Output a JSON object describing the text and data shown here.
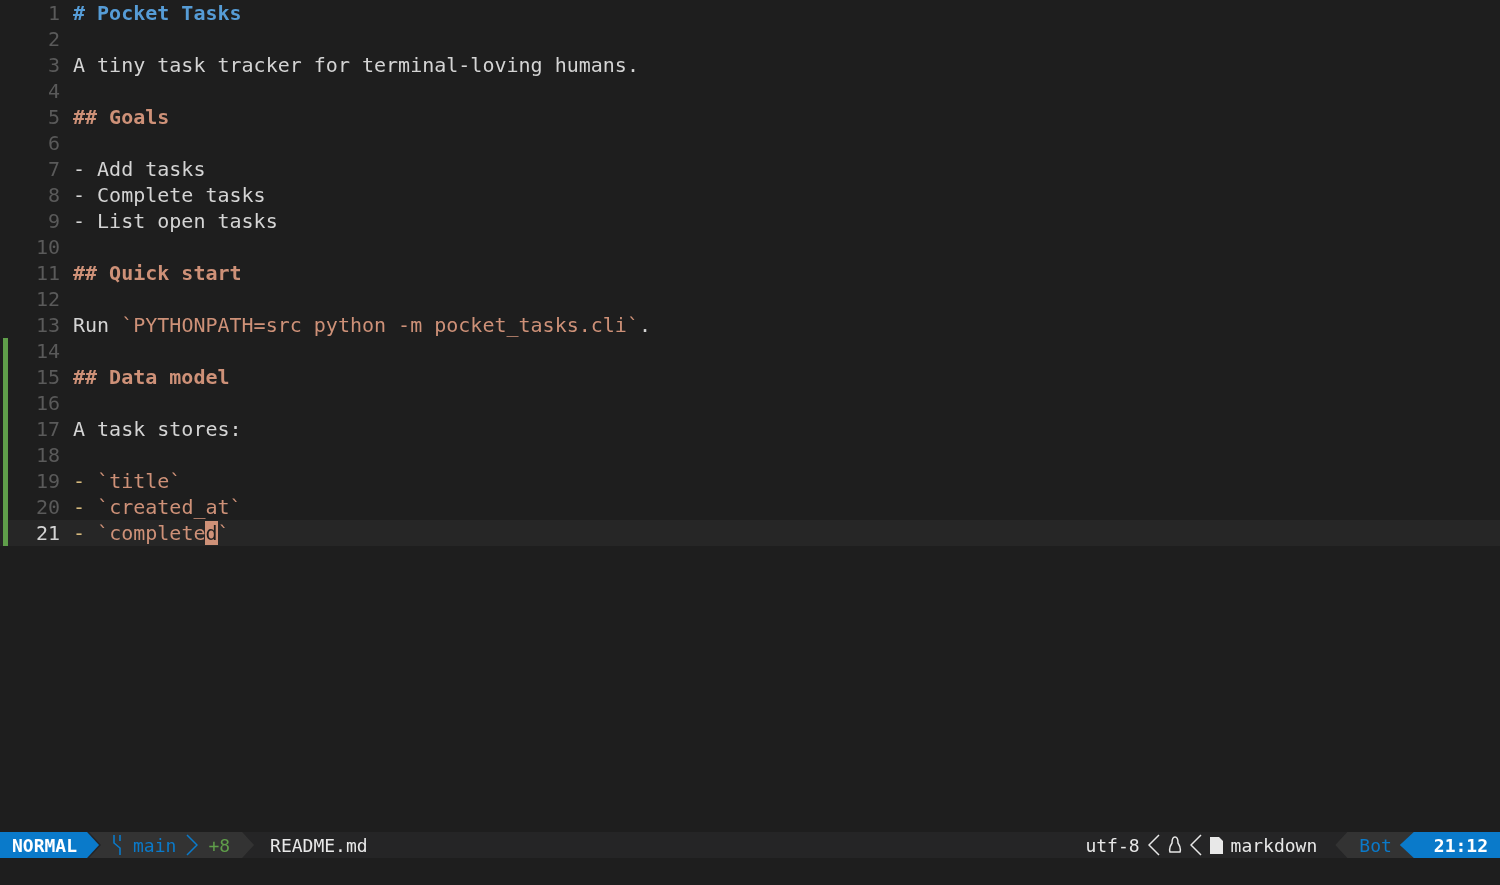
{
  "lines": [
    {
      "number": "1",
      "changed": false,
      "current": false,
      "segments": [
        {
          "kind": "heading1",
          "text": "# Pocket Tasks"
        }
      ]
    },
    {
      "number": "2",
      "changed": false,
      "current": false
    },
    {
      "number": "3",
      "changed": false,
      "current": false,
      "segments": [
        {
          "kind": "text",
          "text": "A tiny task tracker for terminal-loving humans."
        }
      ]
    },
    {
      "number": "4",
      "changed": false,
      "current": false
    },
    {
      "number": "5",
      "changed": false,
      "current": false,
      "segments": [
        {
          "kind": "heading2",
          "text": "## Goals"
        }
      ]
    },
    {
      "number": "6",
      "changed": false,
      "current": false
    },
    {
      "number": "7",
      "changed": false,
      "current": false,
      "segments": [
        {
          "kind": "text",
          "text": "- Add tasks"
        }
      ]
    },
    {
      "number": "8",
      "changed": false,
      "current": false,
      "segments": [
        {
          "kind": "text",
          "text": "- Complete tasks"
        }
      ]
    },
    {
      "number": "9",
      "changed": false,
      "current": false,
      "segments": [
        {
          "kind": "text",
          "text": "- List open tasks"
        }
      ]
    },
    {
      "number": "10",
      "changed": false,
      "current": false
    },
    {
      "number": "11",
      "changed": false,
      "current": false,
      "segments": [
        {
          "kind": "heading2",
          "text": "## Quick start"
        }
      ]
    },
    {
      "number": "12",
      "changed": false,
      "current": false
    },
    {
      "number": "13",
      "changed": false,
      "current": false,
      "segments": [
        {
          "kind": "text",
          "text": "Run "
        },
        {
          "kind": "code",
          "text": "`PYTHONPATH=src python -m pocket_tasks.cli`"
        },
        {
          "kind": "text",
          "text": "."
        }
      ]
    },
    {
      "number": "14",
      "changed": true,
      "current": false
    },
    {
      "number": "15",
      "changed": true,
      "current": false,
      "segments": [
        {
          "kind": "heading2",
          "text": "## Data model"
        }
      ]
    },
    {
      "number": "16",
      "changed": true,
      "current": false
    },
    {
      "number": "17",
      "changed": true,
      "current": false,
      "segments": [
        {
          "kind": "text",
          "text": "A task stores:"
        }
      ]
    },
    {
      "number": "18",
      "changed": true,
      "current": false
    },
    {
      "number": "19",
      "changed": true,
      "current": false,
      "segments": [
        {
          "kind": "bullet",
          "text": "- "
        },
        {
          "kind": "code",
          "text": "`title`"
        }
      ]
    },
    {
      "number": "20",
      "changed": true,
      "current": false,
      "segments": [
        {
          "kind": "bullet",
          "text": "- "
        },
        {
          "kind": "code",
          "text": "`created_at`"
        }
      ]
    },
    {
      "number": "21",
      "changed": true,
      "current": true,
      "segments": [
        {
          "kind": "bullet",
          "text": "- "
        },
        {
          "kind": "code",
          "text": "`complete"
        },
        {
          "kind": "cursor",
          "text": "d"
        },
        {
          "kind": "code",
          "text": "`"
        }
      ]
    }
  ],
  "status_bar": {
    "mode": "NORMAL",
    "branch": "main",
    "changes": "+8",
    "file": "README.md",
    "encoding": "utf-8",
    "filetype": "markdown",
    "position": "Bot",
    "cursor": "21:12"
  }
}
